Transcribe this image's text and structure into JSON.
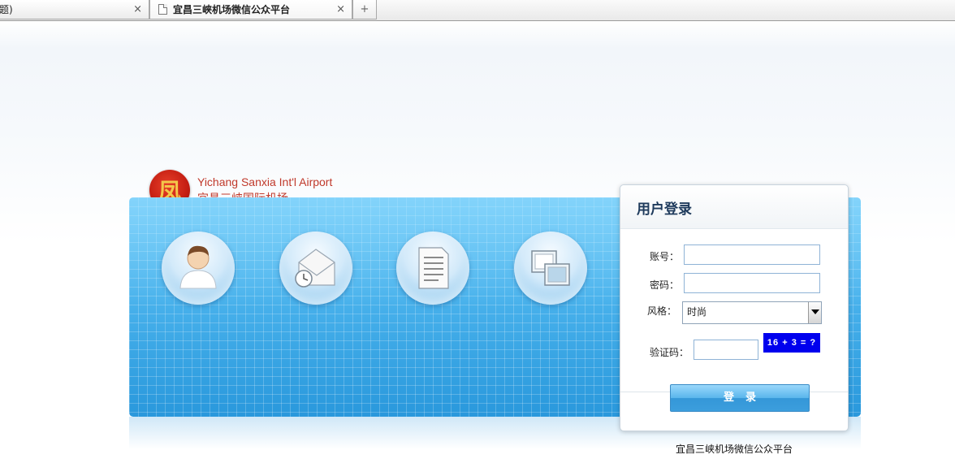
{
  "browser": {
    "tabs": [
      {
        "title": "题)",
        "close": "×",
        "active": false
      },
      {
        "title": "宜昌三峡机场微信公众平台",
        "close": "×",
        "active": true
      }
    ],
    "new_tab": "+"
  },
  "logo": {
    "emblem_char": "凤",
    "english_name": "Yichang Sanxia  Int'l  Airport",
    "chinese_name": "宜昌三峡国际机场"
  },
  "banner": {
    "icons": [
      "user-icon",
      "mail-clock-icon",
      "document-icon",
      "windows-icon"
    ]
  },
  "login": {
    "title": "用户登录",
    "account_label": "账号：",
    "account_value": "",
    "password_label": "密码：",
    "password_value": "",
    "style_label": "风格：",
    "style_selected": "时尚",
    "captcha_label": "验证码：",
    "captcha_value": "",
    "captcha_text": "16 + 3 = ?",
    "submit_label": "登录"
  },
  "footer": {
    "text": "宜昌三峡机场微信公众平台"
  },
  "colors": {
    "banner": "#49b2ec",
    "logo_red": "#c0392b",
    "captcha_bg": "#0000ee",
    "title": "#1e3a5c"
  }
}
